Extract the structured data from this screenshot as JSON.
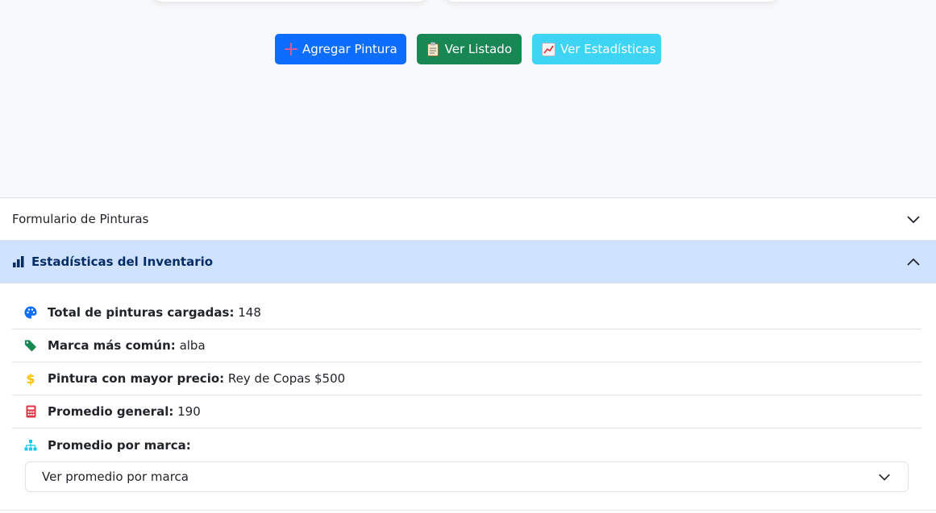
{
  "buttons": {
    "add_label": "Agregar Pintura",
    "list_label": "Ver Listado",
    "stats_label": "Ver Estadísticas"
  },
  "accordion": {
    "form_title": "Formulario de Pinturas",
    "stats_title": "Estadísticas del Inventario"
  },
  "stats": {
    "total": {
      "label": "Total de pinturas cargadas:",
      "value": "148",
      "icon": "palette-icon",
      "color": "#0d6efd"
    },
    "brand": {
      "label": "Marca más común:",
      "value": "alba",
      "icon": "tag-icon",
      "color": "#198754"
    },
    "max_price": {
      "label": "Pintura con mayor precio:",
      "value": "Rey de Copas $500",
      "icon": "dollar-icon",
      "color": "#ffc107"
    },
    "average": {
      "label": "Promedio general:",
      "value": "190",
      "icon": "calculator-icon",
      "color": "#dc3545"
    },
    "by_brand": {
      "label": "Promedio por marca:",
      "icon": "sitemap-icon",
      "color": "#0dcaf0"
    }
  },
  "select": {
    "selected": "Ver promedio por marca"
  }
}
